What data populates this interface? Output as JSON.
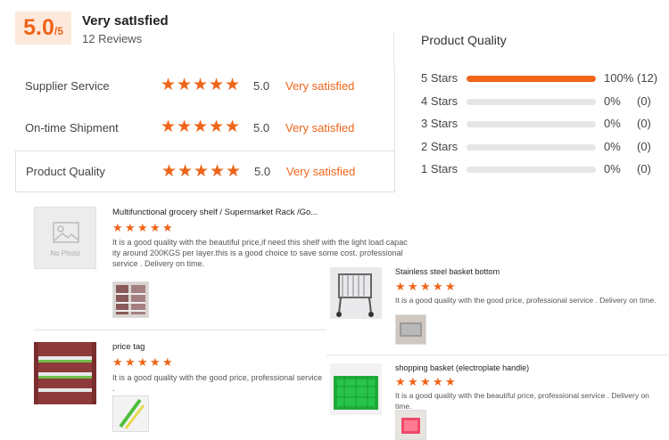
{
  "summary": {
    "score": "5.0",
    "score_max": "/5",
    "title": "Very satIsfied",
    "reviews": "12 Reviews"
  },
  "dimensions": [
    {
      "label": "Supplier Service",
      "stars": 5,
      "score": "5.0",
      "satisfaction": "Very satisfied"
    },
    {
      "label": "On-time Shipment",
      "stars": 5,
      "score": "5.0",
      "satisfaction": "Very satisfied"
    },
    {
      "label": "Product Quality",
      "stars": 5,
      "score": "5.0",
      "satisfaction": "Very satisfied"
    }
  ],
  "distribution": {
    "title": "Product Quality",
    "rows": [
      {
        "label": "5 Stars",
        "fraction": 1.0,
        "percent": "100%",
        "count": "(12)"
      },
      {
        "label": "4 Stars",
        "fraction": 0,
        "percent": "0%",
        "count": "(0)"
      },
      {
        "label": "3 Stars",
        "fraction": 0,
        "percent": "0%",
        "count": "(0)"
      },
      {
        "label": "2 Stars",
        "fraction": 0,
        "percent": "0%",
        "count": "(0)"
      },
      {
        "label": "1 Stars",
        "fraction": 0,
        "percent": "0%",
        "count": "(0)"
      }
    ]
  },
  "reviews": [
    {
      "title": "Multifunctional grocery shelf / Supermarket Rack /Go...",
      "stars": 5,
      "text": "It is a good quality with the beautiful price,if need this shelf with the light load capac ity around 200KGS per layer.this is a good choice to save some cost. professional service . Delivery on time.",
      "thumb_text": "No Photo"
    },
    {
      "title": "Stainless steel basket bottom",
      "stars": 5,
      "text": "It is a good quality with the good price, professional service . Delivery on time."
    },
    {
      "title": "price tag",
      "stars": 5,
      "text": "It is a good quality with the good price, professional service ."
    },
    {
      "title": "shopping basket (electroplate handle)",
      "stars": 5,
      "text": "It is a good quality with the beautiful price, professional service . Delivery on time."
    }
  ],
  "colors": {
    "accent": "#f06418",
    "accent_bg": "#fde9dc",
    "track": "#e6e6e6"
  }
}
